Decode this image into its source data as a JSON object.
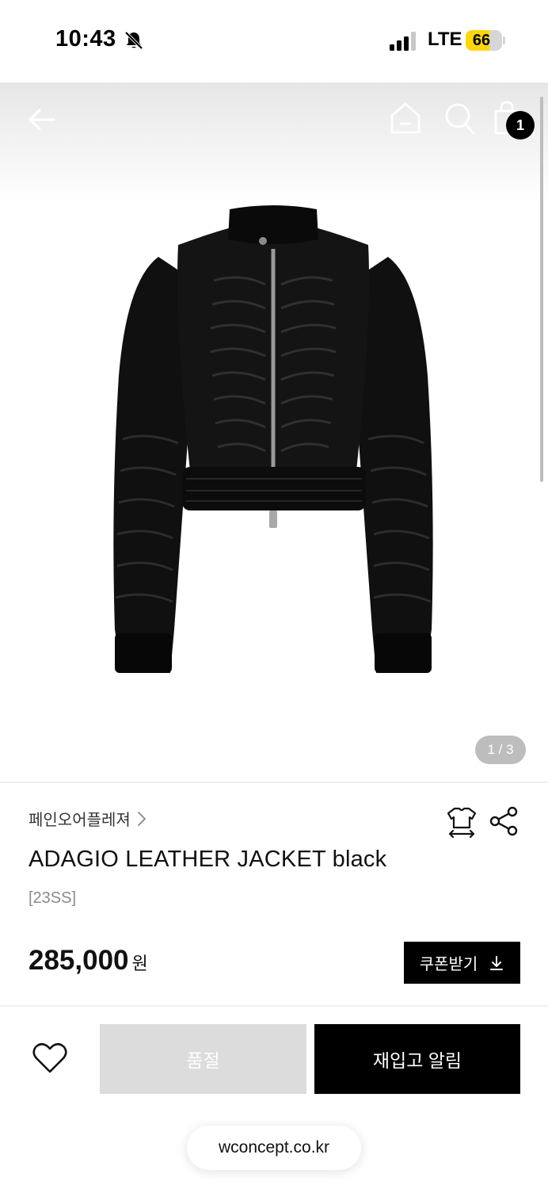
{
  "status_bar": {
    "time": "10:43",
    "network": "LTE",
    "battery_level": "66",
    "battery_fraction": 0.66,
    "icons": [
      "bell-slash-icon",
      "signal-icon",
      "battery-icon"
    ]
  },
  "header": {
    "icons": [
      "back-arrow-icon",
      "home-icon",
      "search-icon",
      "shopping-bag-icon"
    ],
    "cart_count": "1"
  },
  "gallery": {
    "page_indicator": "1 / 3"
  },
  "product": {
    "brand": "페인오어플레져",
    "name": "ADAGIO LEATHER JACKET black",
    "season": "[23SS]",
    "price": "285,000",
    "currency": "원",
    "coupon_label": "쿠폰받기"
  },
  "actions": {
    "soldout_label": "품절",
    "restock_label": "재입고 알림"
  },
  "browser": {
    "url": "wconcept.co.kr"
  },
  "colors": {
    "primary": "#000000",
    "disabled": "#dcdcdc",
    "battery_fill": "#ffd60a"
  }
}
